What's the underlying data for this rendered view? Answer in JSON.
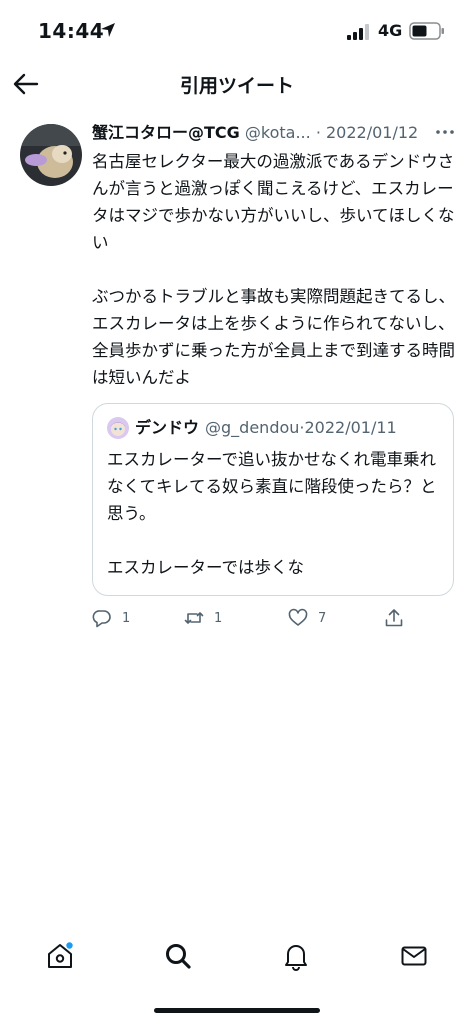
{
  "status_bar": {
    "time": "14:44",
    "network": "4G"
  },
  "nav": {
    "title": "引用ツイート"
  },
  "tweet": {
    "display_name": "蟹江コタロー@TCG",
    "handle": "@kota...",
    "separator": "·",
    "date": "2022/01/12",
    "text": "名古屋セレクター最大の過激派であるデンドウさんが言うと過激っぽく聞こえるけど、エスカレータはマジで歩かない方がいいし、歩いてほしくない\n\nぶつかるトラブルと事故も実際問題起きてるし、エスカレータは上を歩くように作られてないし、全員歩かずに乗った方が全員上まで到達する時間は短いんだよ",
    "quoted": {
      "display_name": "デンドウ",
      "handle": "@g_dendou",
      "separator": "·",
      "date": "2022/01/11",
      "text": "エスカレーターで追い抜かせなくれ電車乗れなくてキレてる奴ら素直に階段使ったら？と思う。\n\nエスカレーターでは歩くな"
    },
    "actions": {
      "replies": "1",
      "retweets": "1",
      "likes": "7"
    }
  },
  "tabbar": {
    "items": [
      "home-icon",
      "search-icon",
      "notifications-icon",
      "messages-icon"
    ],
    "badge_color": "#1d9bf0"
  },
  "colors": {
    "text": "#0f1419",
    "secondary": "#536471",
    "border": "#cfd9de",
    "accent": "#1d9bf0"
  }
}
